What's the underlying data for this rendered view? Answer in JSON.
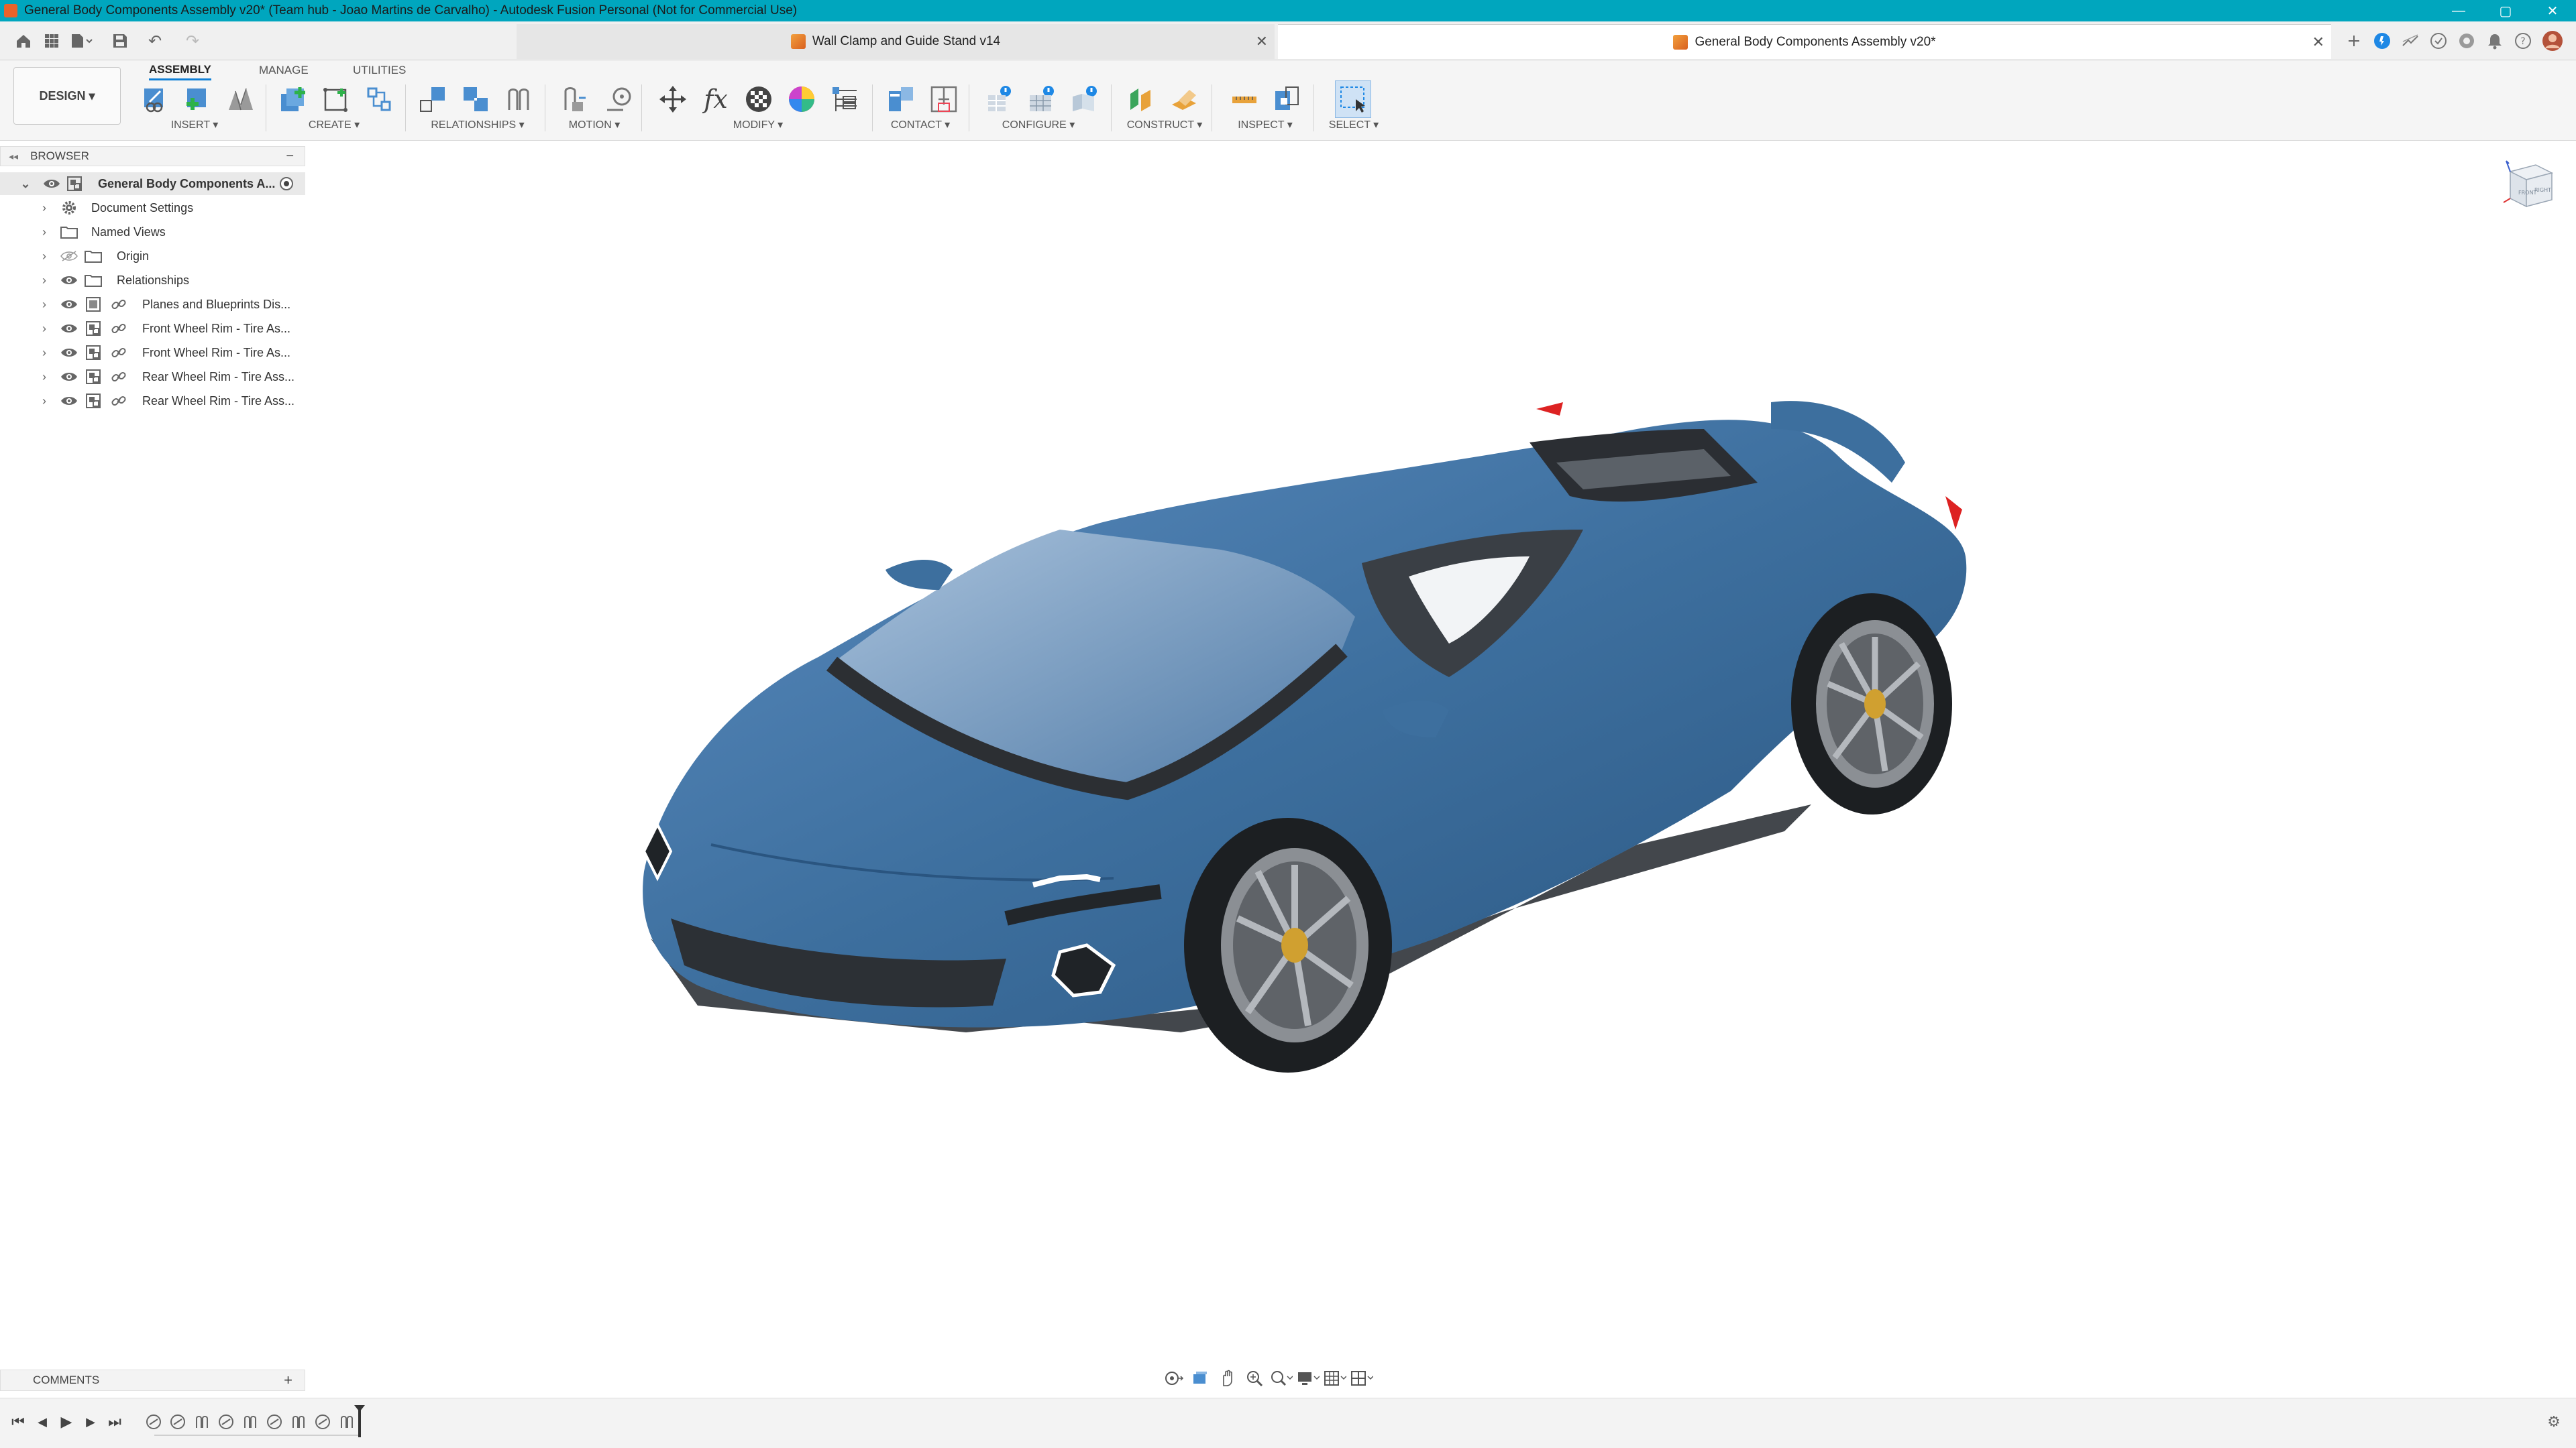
{
  "titlebar": {
    "title": "General Body Components Assembly v20* (Team hub - Joao Martins de Carvalho) - Autodesk Fusion Personal (Not for Commercial Use)",
    "minimize": "—",
    "maximize": "▢",
    "close": "✕"
  },
  "tabs": [
    {
      "label": "Wall Clamp and Guide Stand v14",
      "close": "✕"
    },
    {
      "label": "General Body Components Assembly v20*",
      "close": "✕"
    }
  ],
  "quick_access": {
    "undo": "↶",
    "redo": "↷"
  },
  "toolbar": {
    "design_label": "DESIGN ▾",
    "workspace_tabs": [
      "ASSEMBLY",
      "MANAGE",
      "UTILITIES"
    ],
    "groups": [
      "INSERT ▾",
      "CREATE ▾",
      "RELATIONSHIPS ▾",
      "MOTION ▾",
      "MODIFY ▾",
      "CONTACT ▾",
      "CONFIGURE ▾",
      "CONSTRUCT ▾",
      "INSPECT ▾",
      "SELECT ▾"
    ],
    "fx_label": "fx"
  },
  "browser": {
    "title": "BROWSER",
    "collapse": "−",
    "items": [
      {
        "label": "General Body Components A...",
        "chev": "⌄"
      },
      {
        "label": "Document Settings",
        "chev": "›"
      },
      {
        "label": "Named Views",
        "chev": "›"
      },
      {
        "label": "Origin",
        "chev": "›"
      },
      {
        "label": "Relationships",
        "chev": "›"
      },
      {
        "label": "Planes and Blueprints Dis...",
        "chev": "›"
      },
      {
        "label": "Front Wheel Rim - Tire As...",
        "chev": "›"
      },
      {
        "label": "Front Wheel Rim - Tire As...",
        "chev": "›"
      },
      {
        "label": "Rear Wheel Rim - Tire Ass...",
        "chev": "›"
      },
      {
        "label": "Rear Wheel Rim - Tire Ass...",
        "chev": "›"
      }
    ]
  },
  "viewcube": {
    "front_label": "FRONT",
    "right_label": "RIGHT"
  },
  "comments": {
    "title": "COMMENTS",
    "add": "+"
  },
  "navbar": {
    "icons": [
      "orbit-icon",
      "look-at-icon",
      "pan-icon",
      "zoom-icon",
      "fit-icon",
      "display-settings-icon",
      "grid-icon",
      "viewports-icon"
    ]
  },
  "timeline": {
    "first": "⏮",
    "prev": "◀",
    "play": "▶",
    "next": "▶",
    "last": "⏭",
    "settings": "⚙"
  },
  "colors": {
    "titlebar": "#00a6be",
    "accent": "#0f7fd6",
    "car_body": "#3d6f9e"
  }
}
